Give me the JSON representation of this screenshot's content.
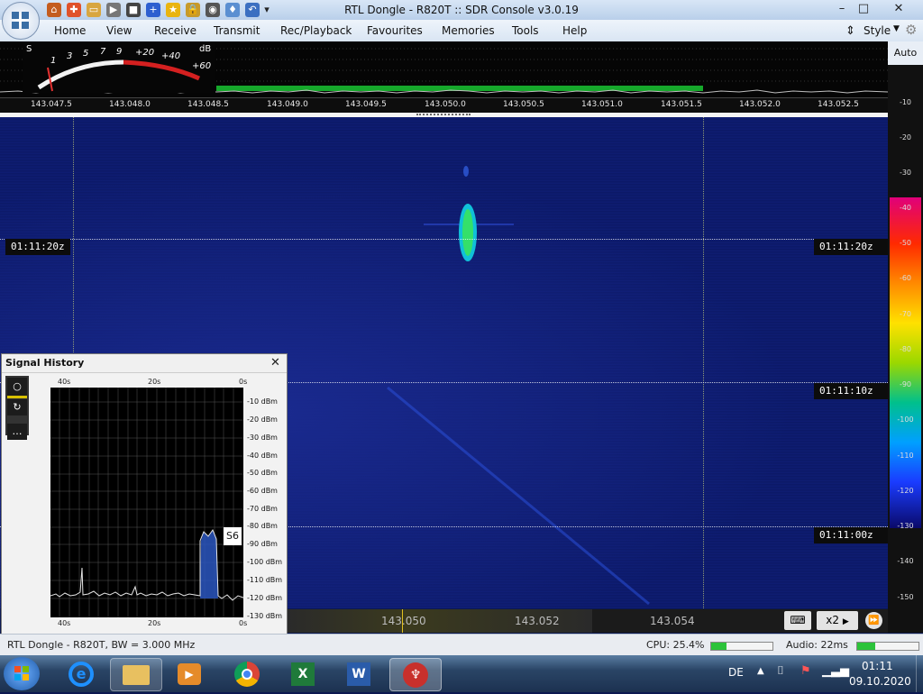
{
  "window": {
    "title": "RTL Dongle - R820T :: SDR Console v3.0.19",
    "controls": [
      "–",
      "□",
      "✕"
    ]
  },
  "menu": {
    "items": [
      "Home",
      "View",
      "Receive",
      "Transmit",
      "Rec/Playback",
      "Favourites",
      "Memories",
      "Tools",
      "Help"
    ],
    "style_label": "Style"
  },
  "smeter": {
    "s_label": "S",
    "db_label": "dB",
    "scale": [
      "1",
      "3",
      "5",
      "7",
      "9",
      "+20",
      "+40",
      "+60"
    ]
  },
  "frequency_scale": [
    "143.047.5",
    "143.048.0",
    "143.048.5",
    "143.049.0",
    "143.049.5",
    "143.050.0",
    "143.050.5",
    "143.051.0",
    "143.051.5",
    "143.052.0",
    "143.052.5"
  ],
  "right_scale": {
    "auto_label": "Auto",
    "values": [
      "-10",
      "-20",
      "-30",
      "-40",
      "-50",
      "-60",
      "-70",
      "-80",
      "-90",
      "-100",
      "-110",
      "-120",
      "-130",
      "-140",
      "-150"
    ]
  },
  "waterfall": {
    "times": [
      "01:11:20z",
      "01:11:10z",
      "01:11:00z"
    ]
  },
  "signal_history": {
    "title": "Signal History",
    "top_axis": [
      "40s",
      "20s",
      "0s"
    ],
    "bottom_axis": [
      "40s",
      "20s",
      "0s"
    ],
    "db_axis": [
      "-10 dBm",
      "-20 dBm",
      "-30 dBm",
      "-40 dBm",
      "-50 dBm",
      "-60 dBm",
      "-70 dBm",
      "-80 dBm",
      "-90 dBm",
      "-100 dBm",
      "-110 dBm",
      "-120 dBm",
      "-130 dBm"
    ],
    "s_badge": "S6",
    "tool_buttons": [
      "○",
      "↻",
      "…"
    ]
  },
  "bottom_freq": {
    "labels": [
      "143.050",
      "143.052",
      "143.054"
    ],
    "zoom": "x2"
  },
  "status": {
    "device": "RTL Dongle - R820T, BW = 3.000 MHz",
    "cpu": "CPU: 25.4%",
    "cpu_level": 0.254,
    "audio": "Audio: 22ms",
    "audio_level": 0.3
  },
  "taskbar": {
    "lang": "DE",
    "time": "01:11",
    "date": "09.10.2020"
  },
  "colors": {
    "accent": "#3a6ea5",
    "waterfall_bg": "#0c1a6a",
    "signal_green": "#2fd27a"
  }
}
